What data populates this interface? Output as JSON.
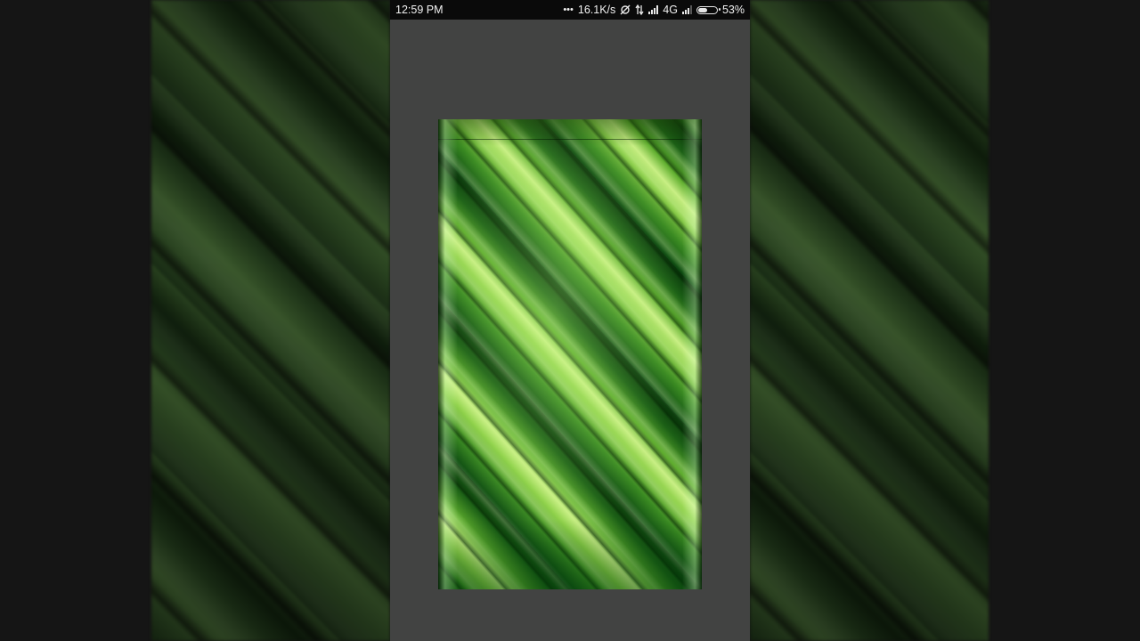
{
  "status_bar": {
    "time": "12:59 PM",
    "overflow_dots": "•••",
    "network_speed": "16.1K/s",
    "network_type": "4G",
    "battery_percent": "53%",
    "battery_level": 0.53
  },
  "wallpaper_preview": {
    "description_icon": "leaf-wallpaper"
  },
  "colors": {
    "screen_background": "#424342",
    "status_bar_background": "#0a0a0a",
    "page_background": "#151515"
  }
}
